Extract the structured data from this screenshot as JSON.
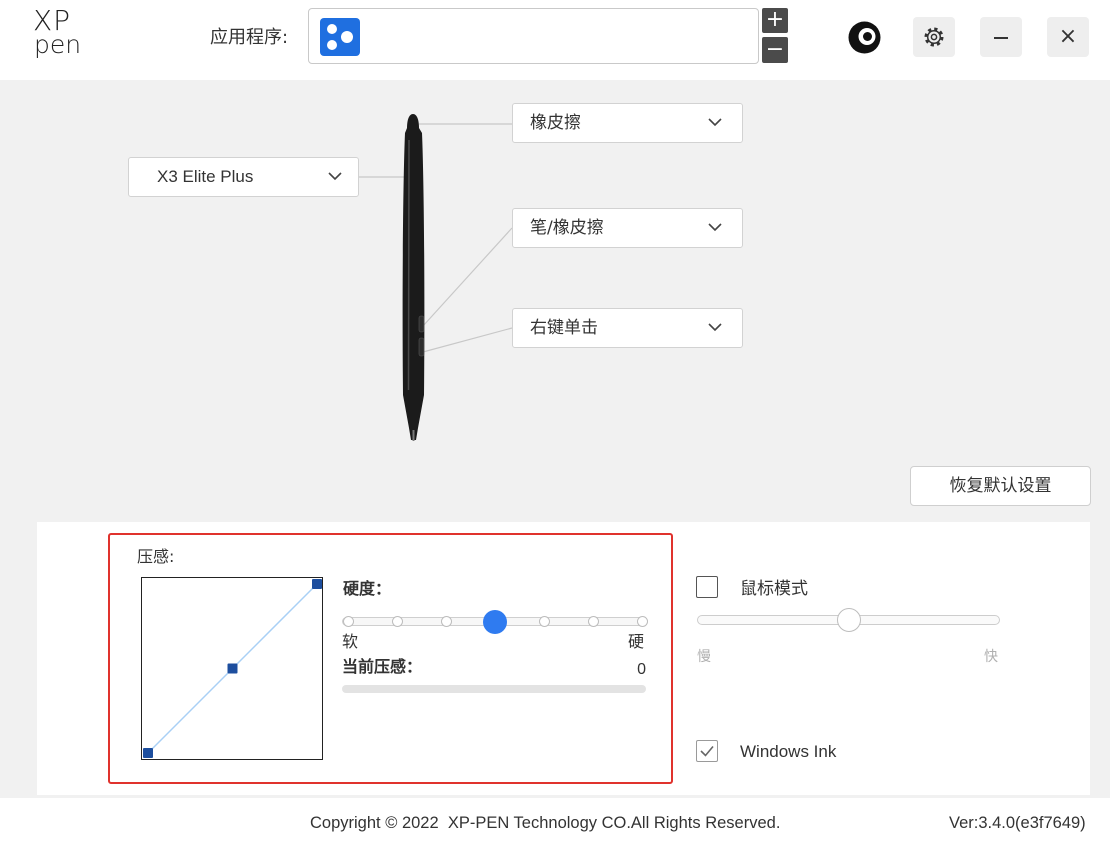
{
  "header": {
    "logo": {
      "line1": "XP",
      "line2": "pen"
    },
    "app_label": "应用程序:",
    "app_icon": "all-apps-icon",
    "add_app_icon": "plus-icon",
    "remove_app_icon": "minus-icon",
    "brand_icon": "xppen-ring-icon",
    "settings_icon": "gear-icon",
    "minimize_icon": "minimize-icon",
    "close_icon": "close-icon",
    "plus_glyph": "+",
    "minus_glyph": "−",
    "close_glyph": "×"
  },
  "pen": {
    "device": "X3 Elite Plus",
    "top_button": "橡皮擦",
    "upper_button": "笔/橡皮擦",
    "lower_button": "右键单击",
    "dropdown_icon": "chevron-down-icon",
    "reset_button": "恢复默认设置"
  },
  "pressure": {
    "title": "压感:",
    "curve": {
      "input": [
        0,
        50,
        100
      ],
      "output": [
        0,
        50,
        100
      ]
    },
    "hardness_label": "硬度：",
    "hardness": {
      "positions": 7,
      "selected": 4
    },
    "soft_label": "软",
    "hard_label": "硬",
    "current_label": "当前压感：",
    "current_value": "0",
    "current_fraction": 0
  },
  "mouse_mode": {
    "label": "鼠标模式",
    "checked": false,
    "speed": 0.5,
    "slow_label": "慢",
    "fast_label": "快"
  },
  "windows_ink": {
    "label": "Windows Ink",
    "checked": true
  },
  "footer": {
    "copyright": "Copyright © 2022  XP-PEN Technology CO.All Rights Reserved.",
    "version": "Ver:3.4.0(e3f7649)"
  },
  "colors": {
    "accent": "#2f7bf0",
    "curve_point": "#1d4e9e",
    "curve_line": "#a9d0f5",
    "highlight_border": "#e0322d",
    "app_icon": "#1f6fe0",
    "content_bg": "#f1f1f1"
  }
}
